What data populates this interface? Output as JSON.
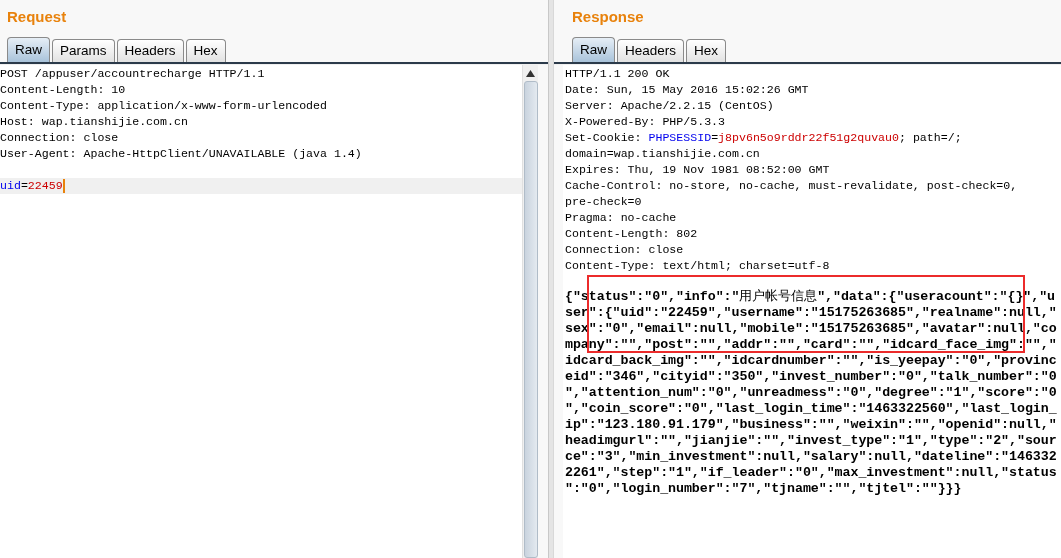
{
  "request": {
    "title": "Request",
    "tabs": [
      {
        "label": "Raw",
        "selected": true
      },
      {
        "label": "Params",
        "selected": false
      },
      {
        "label": "Headers",
        "selected": false
      },
      {
        "label": "Hex",
        "selected": false
      }
    ],
    "header_lines": [
      "POST /appuser/accountrecharge HTTP/1.1",
      "Content-Length: 10",
      "Content-Type: application/x-www-form-urlencoded",
      "Host: wap.tianshijie.com.cn",
      "Connection: close",
      "User-Agent: Apache-HttpClient/UNAVAILABLE (java 1.4)"
    ],
    "body_lines": [
      {
        "current": true,
        "segments": [
          {
            "kind": "name",
            "text": "uid"
          },
          {
            "kind": "plain",
            "text": "="
          },
          {
            "kind": "value",
            "text": "22459"
          }
        ]
      }
    ]
  },
  "response": {
    "title": "Response",
    "tabs": [
      {
        "label": "Raw",
        "selected": true
      },
      {
        "label": "Headers",
        "selected": false
      },
      {
        "label": "Hex",
        "selected": false
      }
    ],
    "header_lines": [
      "HTTP/1.1 200 OK",
      "Date: Sun, 15 May 2016 15:02:26 GMT",
      "Server: Apache/2.2.15 (CentOS)",
      "X-Powered-By: PHP/5.3.3",
      [
        {
          "kind": "plain",
          "text": "Set-Cookie: "
        },
        {
          "kind": "name",
          "text": "PHPSESSID"
        },
        {
          "kind": "plain",
          "text": "="
        },
        {
          "kind": "value",
          "text": "j8pv6n5o9rddr22f51g2quvau0"
        },
        {
          "kind": "plain",
          "text": "; path=/;"
        }
      ],
      "domain=wap.tianshijie.com.cn",
      "Expires: Thu, 19 Nov 1981 08:52:00 GMT",
      "Cache-Control: no-store, no-cache, must-revalidate, post-check=0,",
      "pre-check=0",
      "Pragma: no-cache",
      "Content-Length: 802",
      "Connection: close",
      "Content-Type: text/html; charset=utf-8"
    ],
    "body_lines": [
      "{\"status\":\"0\",\"info\":\"用户帐号信息\",\"data\":{\"useracount\":\"{}\",\"u",
      "ser\":{\"uid\":\"22459\",\"username\":\"15175263685\",\"realname\":null,\"",
      "sex\":\"0\",\"email\":null,\"mobile\":\"15175263685\",\"avatar\":null,\"co",
      "mpany\":\"\",\"post\":\"\",\"addr\":\"\",\"card\":\"\",\"idcard_face_img\":\"\",\"",
      "idcard_back_img\":\"\",\"idcardnumber\":\"\",\"is_yeepay\":\"0\",\"provinc",
      "eid\":\"346\",\"cityid\":\"350\",\"invest_number\":\"0\",\"talk_number\":\"0",
      "\",\"attention_num\":\"0\",\"unreadmess\":\"0\",\"degree\":\"1\",\"score\":\"0",
      "\",\"coin_score\":\"0\",\"last_login_time\":\"1463322560\",\"last_login_",
      "ip\":\"123.180.91.179\",\"business\":\"\",\"weixin\":\"\",\"openid\":null,\"",
      "headimgurl\":\"\",\"jianjie\":\"\",\"invest_type\":\"1\",\"type\":\"2\",\"sour",
      "ce\":\"3\",\"min_investment\":null,\"salary\":null,\"dateline\":\"146332",
      "2261\",\"step\":\"1\",\"if_leader\":\"0\",\"max_investment\":null,\"status",
      "\":\"0\",\"login_number\":\"7\",\"tjname\":\"\",\"tjtel\":\"\"}}}"
    ],
    "annotation": {
      "kind": "rectangle"
    }
  }
}
